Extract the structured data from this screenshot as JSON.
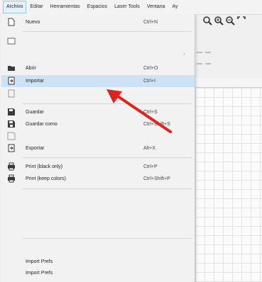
{
  "menubar": {
    "items": [
      "Archivo",
      "Editar",
      "Herramientas",
      "Espacios",
      "Laser Tools",
      "Ventana",
      "Ay"
    ]
  },
  "menu": {
    "items": [
      {
        "label": "Nuevo",
        "shortcut": "Ctrl+N",
        "icon": "new-file-icon"
      },
      {
        "label": "Abrir",
        "shortcut": "Ctrl+O",
        "icon": "open-folder-icon"
      },
      {
        "label": "Importar",
        "shortcut": "Ctrl+I",
        "icon": "import-icon"
      },
      {
        "label": "Guardar",
        "shortcut": "Ctrl+S",
        "icon": "save-icon"
      },
      {
        "label": "Guardar como",
        "shortcut": "Ctrl+Shift+S",
        "icon": "save-as-icon"
      },
      {
        "label": "Exportar",
        "shortcut": "Alt+X",
        "icon": "export-icon"
      },
      {
        "label": "Print (black only)",
        "shortcut": "Ctrl+P",
        "icon": "printer-icon"
      },
      {
        "label": "Print (keep colors)",
        "shortcut": "Ctrl+Shift+P",
        "icon": "printer-color-icon"
      },
      {
        "label": "Import Prefs"
      },
      {
        "label": "Import Prefs"
      }
    ]
  },
  "colors": {
    "highlight": "#cde3f5",
    "arrow": "#e0231c"
  }
}
